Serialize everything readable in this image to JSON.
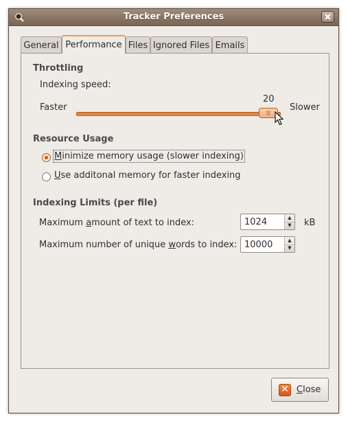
{
  "window": {
    "title": "Tracker Preferences"
  },
  "tabs": [
    {
      "label": "General",
      "active": false
    },
    {
      "label": "Performance",
      "active": true
    },
    {
      "label": "Files",
      "active": false
    },
    {
      "label": "Ignored Files",
      "active": false
    },
    {
      "label": "Emails",
      "active": false
    }
  ],
  "throttling": {
    "heading": "Throttling",
    "speed_label": "Indexing speed:",
    "faster_label": "Faster",
    "slower_label": "Slower",
    "value": "20",
    "min": 0,
    "max": 20
  },
  "resource_usage": {
    "heading": "Resource Usage",
    "options": [
      {
        "mnemonic": "M",
        "rest": "inimize memory usage (slower indexing)",
        "checked": true
      },
      {
        "mnemonic": "U",
        "rest": "se additonal memory for faster indexing",
        "checked": false
      }
    ]
  },
  "limits": {
    "heading": "Indexing Limits (per file)",
    "text_label_pre": "Maximum ",
    "text_label_mnemonic": "a",
    "text_label_post": "mount of text to index:",
    "text_value": "1024",
    "text_unit": "kB",
    "words_label_pre": "Maximum number of unique ",
    "words_label_mnemonic": "w",
    "words_label_post": "ords to index:",
    "words_value": "10000"
  },
  "footer": {
    "close_mnemonic": "C",
    "close_rest": "lose"
  },
  "icons": {
    "window": "tracker-app-icon",
    "close_window": "close-icon",
    "close_button": "close-x-icon",
    "pointer": "mouse-pointer-icon",
    "spin_up": "arrow-up-icon",
    "spin_down": "arrow-down-icon"
  },
  "colors": {
    "accent": "#e8904b",
    "titlebar": "#8a7563",
    "window_bg": "#efebe7"
  }
}
